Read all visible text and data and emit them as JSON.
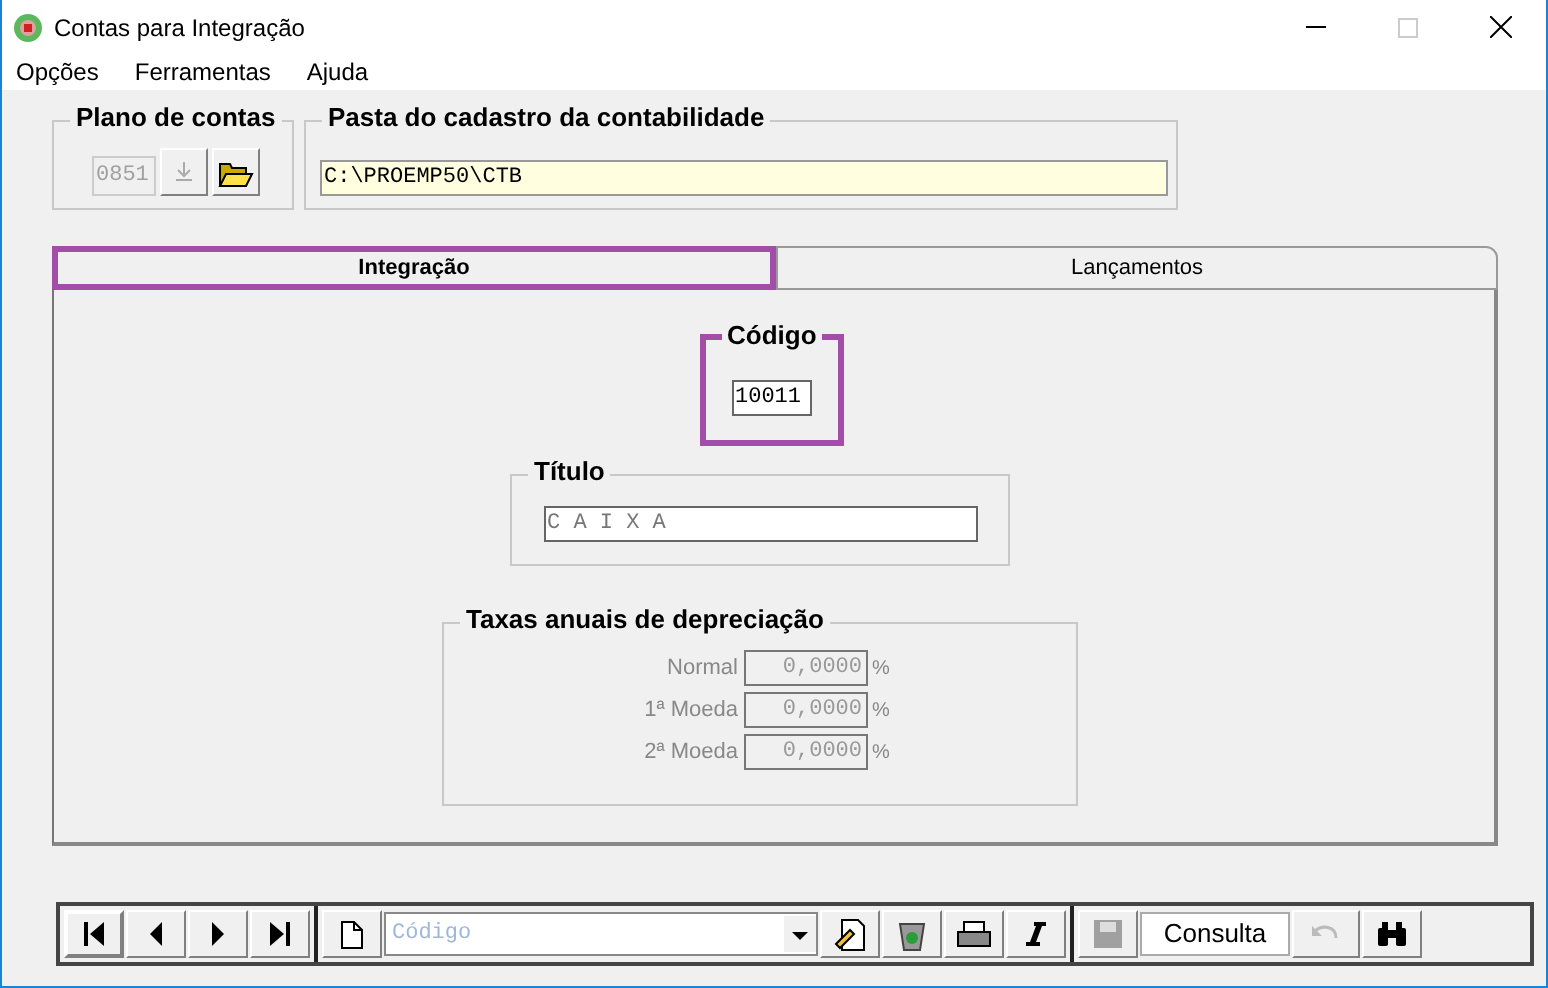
{
  "window": {
    "title": "Contas para Integração"
  },
  "menu": [
    "Opções",
    "Ferramentas",
    "Ajuda"
  ],
  "plano": {
    "label": "Plano de contas",
    "value": "0851"
  },
  "pasta": {
    "label": "Pasta do cadastro da contabilidade",
    "value": "C:\\PROEMP50\\CTB"
  },
  "tabs": [
    {
      "label": "Integração",
      "selected": true,
      "highlighted": true
    },
    {
      "label": "Lançamentos",
      "selected": false,
      "highlighted": false
    }
  ],
  "codigo": {
    "label": "Código",
    "value": "10011",
    "highlighted": true
  },
  "titulo": {
    "label": "Título",
    "value": "C A I X A"
  },
  "taxas": {
    "label": "Taxas anuais de depreciação",
    "rows": [
      {
        "label": "Normal",
        "value": "0,0000",
        "unit": "%"
      },
      {
        "label": "1ª Moeda",
        "value": "0,0000",
        "unit": "%"
      },
      {
        "label": "2ª Moeda",
        "value": "0,0000",
        "unit": "%"
      }
    ]
  },
  "toolbar": {
    "search_placeholder": "Código",
    "mode": "Consulta"
  }
}
